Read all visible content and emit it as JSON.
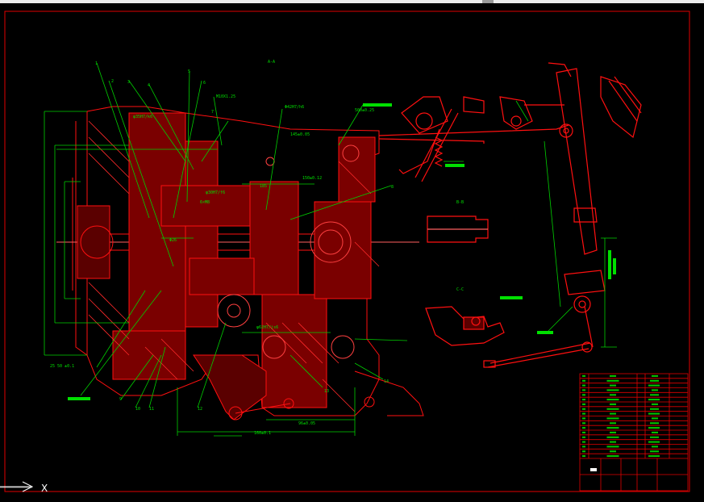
{
  "window": {
    "title_strip": ""
  },
  "drawing": {
    "view_labels": {
      "section_aa": "A-A",
      "section_bb": "B-B",
      "section_cc": "C-C"
    },
    "callouts": {
      "c1": "1",
      "c2": "2",
      "c3": "3",
      "c4": "4",
      "c5": "5",
      "c6": "6",
      "c7": "7",
      "c8": "8",
      "c9": "9",
      "c10": "10",
      "c11": "11",
      "c12": "12",
      "c13": "13",
      "c14": "14"
    },
    "dims": {
      "d1": "M10X1.25",
      "d2": "Φ42H7/h6",
      "d3": "φ35H7/k6",
      "d4": "φ30H7/f6",
      "d5": "Φ26",
      "d6": "185",
      "d7": "150±0.12",
      "d8": "25 50 ±0.1",
      "d9": "φ62H7/js6",
      "d10": "96±0.05",
      "d11": "160±0.1",
      "d12": "500±0.25",
      "d13": "6×M8",
      "d14": "145±0.05"
    }
  },
  "title_block": {
    "rows": 18,
    "footer": ""
  },
  "ucs": {
    "x_label": "X"
  }
}
